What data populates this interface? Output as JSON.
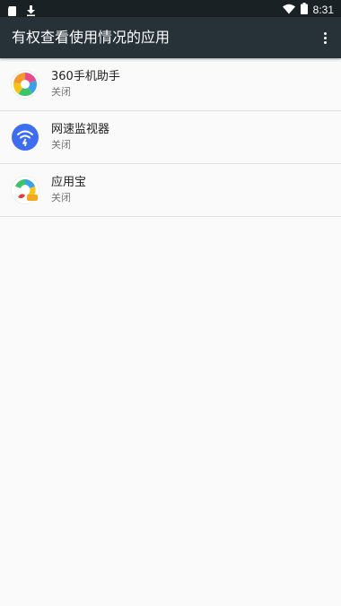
{
  "status_bar": {
    "time": "8:31",
    "left_icons": [
      "sd-card-icon",
      "download-icon"
    ],
    "right_icons": [
      "wifi-icon",
      "battery-icon"
    ]
  },
  "app_bar": {
    "title": "有权查看使用情况的应用",
    "menu_icon": "more-vert-icon"
  },
  "apps": [
    {
      "name": "360手机助手",
      "status": "关闭",
      "icon": "360-assistant-icon"
    },
    {
      "name": "网速监视器",
      "status": "关闭",
      "icon": "net-speed-monitor-icon"
    },
    {
      "name": "应用宝",
      "status": "关闭",
      "icon": "app-treasure-icon"
    }
  ],
  "colors": {
    "status_bar_bg": "#1a2124",
    "app_bar_bg": "#263238",
    "background": "#fafafa",
    "divider": "#e0e0e0",
    "net_speed_blue": "#3d6ef0"
  }
}
